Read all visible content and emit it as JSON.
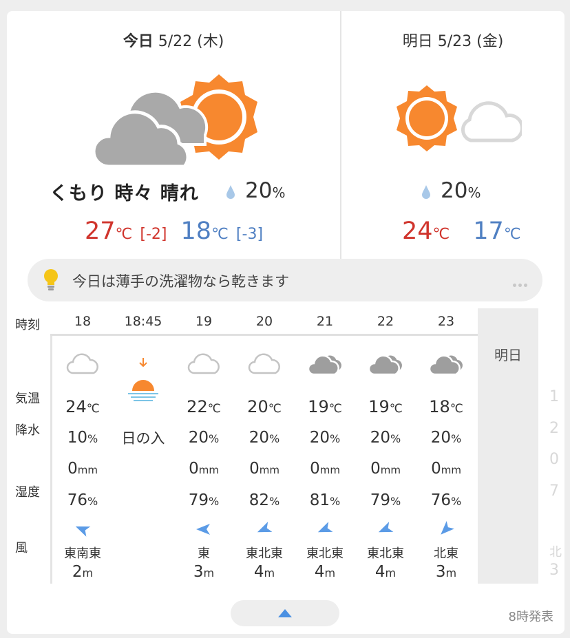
{
  "today": {
    "title_bold": "今日",
    "title_date": "5/22 (木)",
    "weather": "くもり 時々 晴れ",
    "icon": "cloudy-then-sunny-icon",
    "pop": "20",
    "pop_unit": "%",
    "high": "27",
    "high_diff": "[-2]",
    "low": "18",
    "low_diff": "[-3]",
    "deg_unit": "℃"
  },
  "tomorrow": {
    "title": "明日 5/23 (金)",
    "icon": "sunny-then-cloudy-icon",
    "pop": "20",
    "pop_unit": "%",
    "high": "24",
    "low": "17",
    "deg_unit": "℃"
  },
  "tip": {
    "text": "今日は薄手の洗濯物なら乾きます",
    "icon": "lightbulb-icon"
  },
  "labels": {
    "time": "時刻",
    "temp": "気温",
    "precip": "降水",
    "humidity": "湿度",
    "wind": "風",
    "tomorrow": "明日"
  },
  "units": {
    "temp": "℃",
    "percent": "%",
    "mm": "mm",
    "m": "m"
  },
  "hours": [
    {
      "time": "18",
      "icon": "cloud-light-icon",
      "temp": "24",
      "precip": "10",
      "mm": "0",
      "humidity": "76",
      "wind_dir": "東南東",
      "wind_speed": "2",
      "wind_deg": 112
    },
    {
      "time": "18:45",
      "icon": "sunset-icon",
      "event": "日の入"
    },
    {
      "time": "19",
      "icon": "cloud-light-icon",
      "temp": "22",
      "precip": "20",
      "mm": "0",
      "humidity": "79",
      "wind_dir": "東",
      "wind_speed": "3",
      "wind_deg": 90
    },
    {
      "time": "20",
      "icon": "cloud-light-icon",
      "temp": "20",
      "precip": "20",
      "mm": "0",
      "humidity": "82",
      "wind_dir": "東北東",
      "wind_speed": "4",
      "wind_deg": 67
    },
    {
      "time": "21",
      "icon": "cloud-dark-icon",
      "temp": "19",
      "precip": "20",
      "mm": "0",
      "humidity": "81",
      "wind_dir": "東北東",
      "wind_speed": "4",
      "wind_deg": 67
    },
    {
      "time": "22",
      "icon": "cloud-dark-icon",
      "temp": "19",
      "precip": "20",
      "mm": "0",
      "humidity": "79",
      "wind_dir": "東北東",
      "wind_speed": "4",
      "wind_deg": 67
    },
    {
      "time": "23",
      "icon": "cloud-dark-icon",
      "temp": "18",
      "precip": "20",
      "mm": "0",
      "humidity": "76",
      "wind_dir": "北東",
      "wind_speed": "3",
      "wind_deg": 45
    }
  ],
  "ghost": {
    "temp": "1",
    "precip": "2",
    "mm": "0",
    "humidity": "7",
    "wind_dir": "北",
    "wind_speed": "3"
  },
  "footer": {
    "issued": "8時発表",
    "collapse_icon": "triangle-up-icon"
  },
  "colors": {
    "high": "#d0342c",
    "low": "#4f7fc2",
    "sun": "#f7882f",
    "cloud_gray": "#a9a9a9",
    "wind_arrow": "#5b9be6"
  }
}
